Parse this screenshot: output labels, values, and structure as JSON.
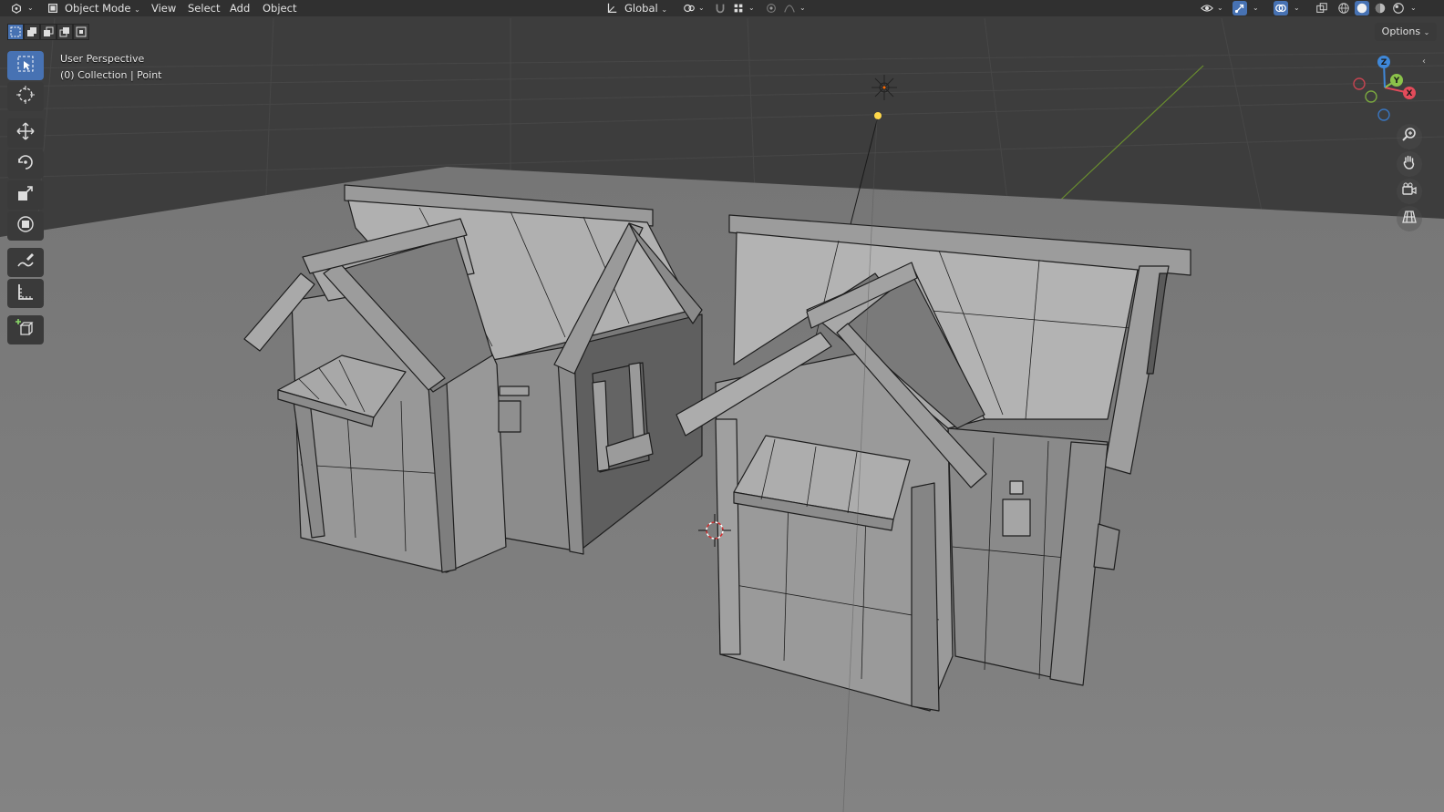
{
  "header": {
    "editor_type_icon": "viewport-icon",
    "mode": {
      "icon": "object-mode-icon",
      "label": "Object Mode"
    },
    "menus": [
      "View",
      "Select",
      "Add",
      "Object"
    ],
    "transform_orientation": {
      "icon": "global-orientation-icon",
      "label": "Global"
    },
    "pivot_icon": "pivot-point-icon",
    "snap_icons": [
      "snap-magnet-icon",
      "snap-increment-icon"
    ],
    "proportional_icons": [
      "proportional-edit-icon",
      "falloff-curve-icon"
    ],
    "right_icons": [
      "visibility-eye-icon",
      "gizmo-toggle-icon",
      "overlays-icon",
      "xray-icon",
      "shading-wireframe-icon",
      "shading-solid-icon",
      "shading-material-icon",
      "shading-rendered-icon"
    ]
  },
  "toolbar_row": {
    "select_mode_icons": [
      "select-box-new-icon",
      "select-extend-icon",
      "select-subtract-icon",
      "select-invert-icon",
      "select-intersect-icon"
    ],
    "options_label": "Options"
  },
  "tools": [
    {
      "name": "select-box",
      "icon": "select-box-icon",
      "active": true
    },
    {
      "name": "cursor",
      "icon": "cursor-icon",
      "active": false
    },
    {
      "name": "move",
      "icon": "move-icon",
      "active": false
    },
    {
      "name": "rotate",
      "icon": "rotate-icon",
      "active": false
    },
    {
      "name": "scale",
      "icon": "scale-icon",
      "active": false
    },
    {
      "name": "transform",
      "icon": "transform-icon",
      "active": false
    },
    {
      "name": "annotate",
      "icon": "annotate-icon",
      "active": false
    },
    {
      "name": "measure",
      "icon": "measure-icon",
      "active": false
    },
    {
      "name": "add-cube",
      "icon": "add-cube-icon",
      "active": false
    }
  ],
  "viewport": {
    "view_name": "User Perspective",
    "collection_info": "(0) Collection | Point"
  },
  "navigation": {
    "gizmo_axes": [
      "X",
      "Y",
      "Z"
    ],
    "axis_colors": {
      "x": "#e34b5a",
      "y": "#8bc34a",
      "z": "#3f88d9"
    },
    "buttons": [
      "zoom-icon",
      "pan-hand-icon",
      "camera-view-icon",
      "ortho-grid-icon"
    ]
  },
  "colors": {
    "accent": "#4772b3",
    "header_bg": "#303030",
    "ground": "#7a7a7a",
    "light": "#ffd84a"
  }
}
